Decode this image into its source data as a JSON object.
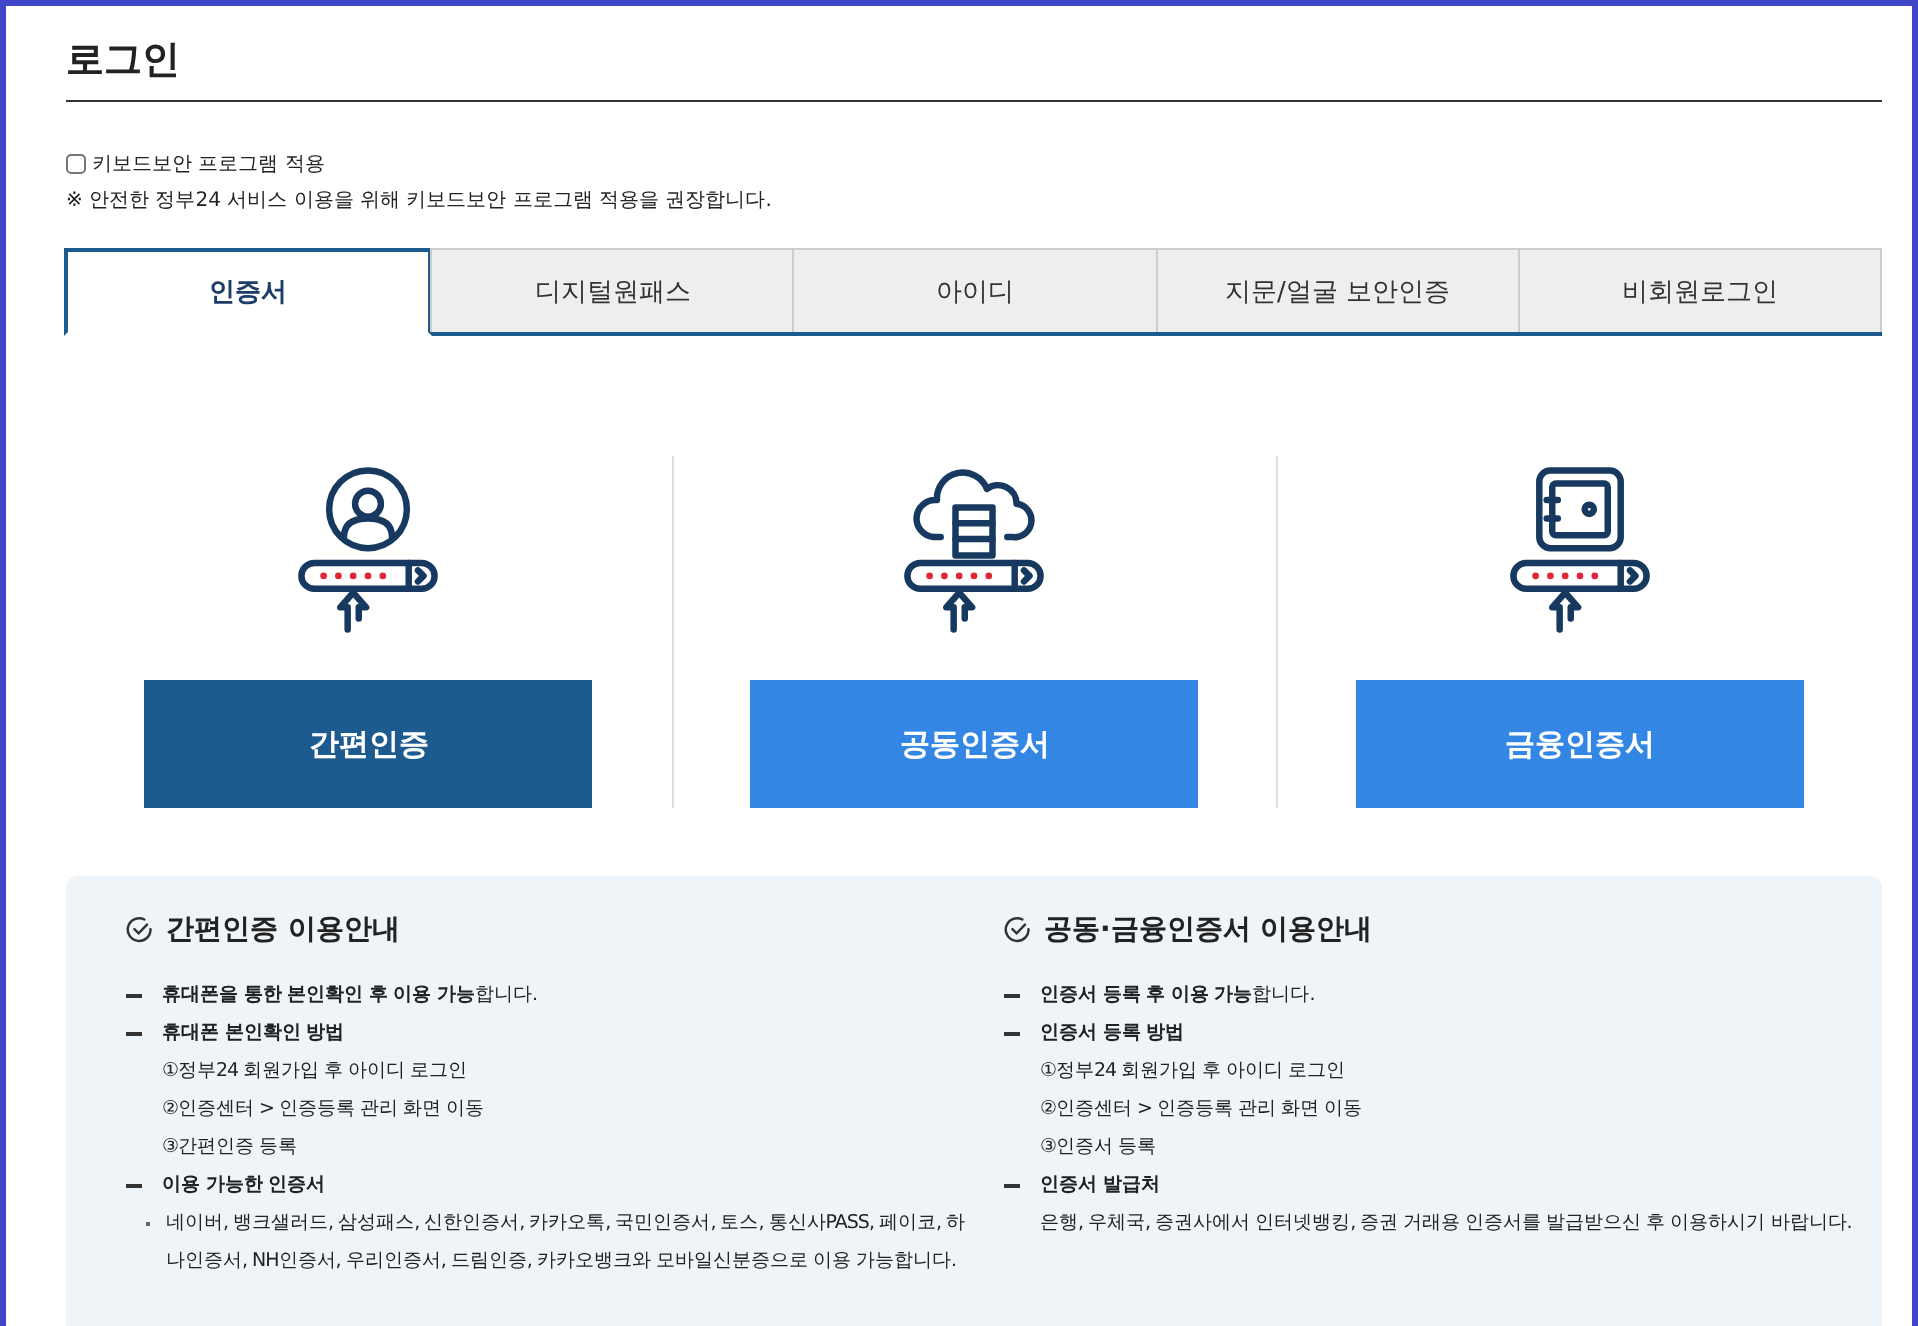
{
  "page_title": "로그인",
  "keyboard_security": {
    "label": "키보드보안 프로그램 적용",
    "checked": false
  },
  "notice": "※ 안전한 정부24 서비스 이용을 위해 키보드보안 프로그램 적용을 권장합니다.",
  "tabs": [
    {
      "label": "인증서",
      "selected": true
    },
    {
      "label": "디지털원패스",
      "selected": false
    },
    {
      "label": "아이디",
      "selected": false
    },
    {
      "label": "지문/얼굴 보안인증",
      "selected": false
    },
    {
      "label": "비회원로그인",
      "selected": false
    }
  ],
  "methods": [
    {
      "kind": "person",
      "label": "간편인증",
      "selected": true
    },
    {
      "kind": "cloud",
      "label": "공동인증서",
      "selected": false
    },
    {
      "kind": "safe",
      "label": "금융인증서",
      "selected": false
    }
  ],
  "guides": [
    {
      "title": "간편인증 이용안내",
      "items": [
        {
          "kind": "dash",
          "text": "**휴대폰을 통한 본인확인 후 이용 가능**합니다."
        },
        {
          "kind": "dash",
          "text": "**휴대폰 본인확인 방법**"
        },
        {
          "kind": "step",
          "text": "①정부24 회원가입 후 아이디 로그인"
        },
        {
          "kind": "step",
          "text": "②인증센터 > 인증등록 관리 화면 이동"
        },
        {
          "kind": "step",
          "text": "③간편인증 등록"
        },
        {
          "kind": "dash",
          "text": "**이용 가능한 인증서**"
        },
        {
          "kind": "bullet",
          "text": "네이버, 뱅크샐러드, 삼성패스, 신한인증서, 카카오톡, 국민인증서, 토스, 통신사PASS, 페이코, 하나인증서, NH인증서, 우리인증서, 드림인증, 카카오뱅크와 모바일신분증으로 이용 가능합니다."
        }
      ]
    },
    {
      "title": "공동·금융인증서 이용안내",
      "items": [
        {
          "kind": "dash",
          "text": "**인증서 등록 후 이용 가능**합니다."
        },
        {
          "kind": "dash",
          "text": "**인증서 등록 방법**"
        },
        {
          "kind": "step",
          "text": "①정부24 회원가입 후 아이디 로그인"
        },
        {
          "kind": "step",
          "text": "②인증센터 > 인증등록 관리 화면 이동"
        },
        {
          "kind": "step",
          "text": "③인증서 등록"
        },
        {
          "kind": "dash",
          "text": "**인증서 발급처**"
        },
        {
          "kind": "step",
          "text": "은행, 우체국, 증권사에서 인터넷뱅킹, 증권 거래용 인증서를 발급받으신 후 이용하시기 바랍니다."
        }
      ]
    }
  ]
}
